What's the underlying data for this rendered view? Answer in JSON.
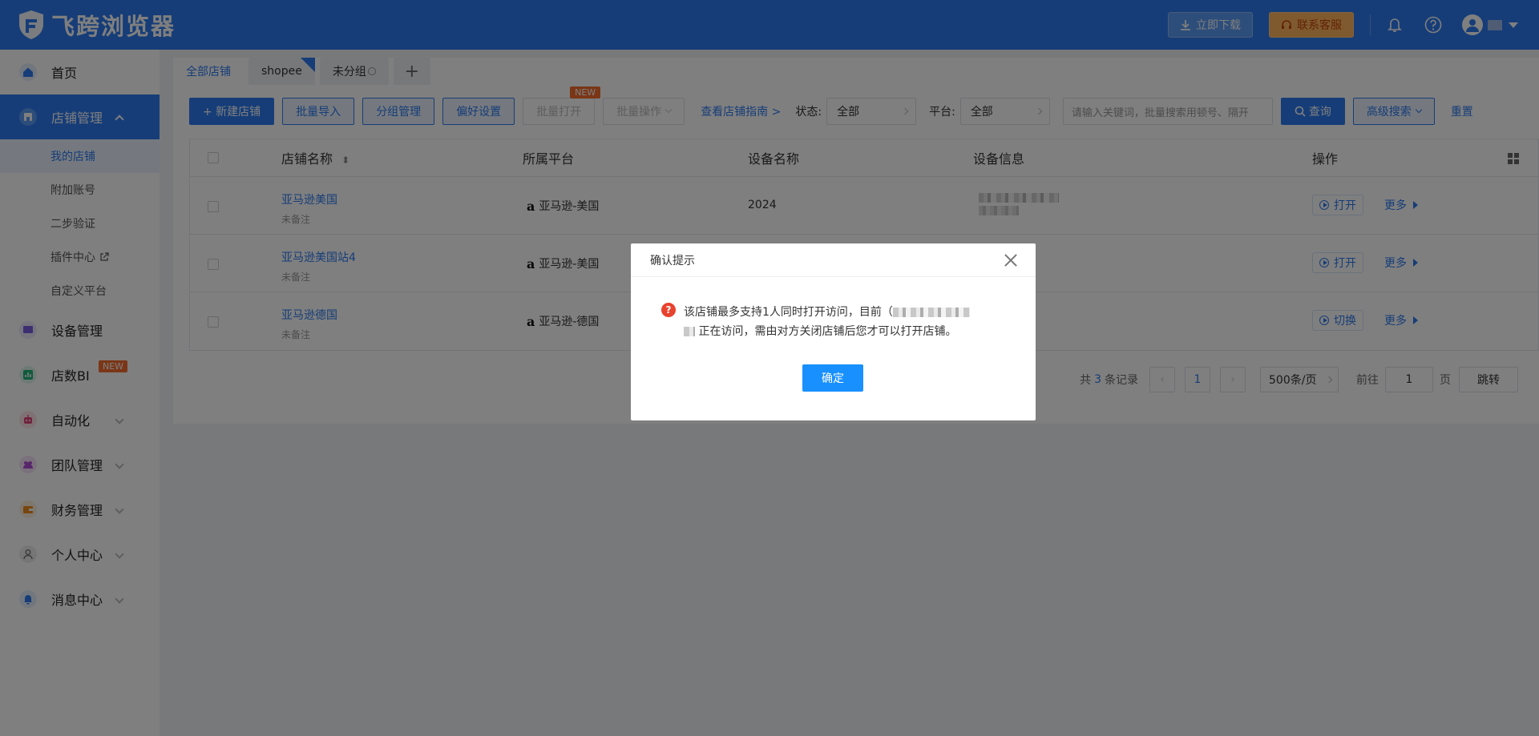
{
  "header": {
    "app_title": "飞跨浏览器",
    "download_label": "立即下载",
    "service_label": "联系客服"
  },
  "sidebar": {
    "items": [
      {
        "label": "首页"
      },
      {
        "label": "店铺管理"
      },
      {
        "label": "设备管理"
      },
      {
        "label": "店数BI",
        "badge": "NEW"
      },
      {
        "label": "自动化"
      },
      {
        "label": "团队管理"
      },
      {
        "label": "财务管理"
      },
      {
        "label": "个人中心"
      },
      {
        "label": "消息中心"
      }
    ],
    "sub_items": [
      {
        "label": "我的店铺"
      },
      {
        "label": "附加账号"
      },
      {
        "label": "二步验证"
      },
      {
        "label": "插件中心"
      },
      {
        "label": "自定义平台"
      }
    ]
  },
  "tabs": [
    {
      "label": "全部店铺"
    },
    {
      "label": "shopee"
    },
    {
      "label": "未分组"
    },
    {
      "label": "+"
    }
  ],
  "toolbar": {
    "new_shop": "+ 新建店铺",
    "batch_import": "批量导入",
    "group_manage": "分组管理",
    "preference": "偏好设置",
    "batch_open": "批量打开",
    "batch_open_badge": "NEW",
    "batch_ops": "批量操作",
    "guide_link": "查看店铺指南 >",
    "status_label": "状态:",
    "status_value": "全部",
    "platform_label": "平台:",
    "platform_value": "全部",
    "search_placeholder": "请输入关键词，批量搜索用顿号、隔开",
    "query": "查询",
    "advanced": "高级搜索",
    "reset": "重置"
  },
  "table": {
    "columns": [
      "店铺名称",
      "所属平台",
      "设备名称",
      "设备信息",
      "操作"
    ],
    "rows": [
      {
        "name": "亚马逊美国",
        "note": "未备注",
        "platform": "亚马逊-美国",
        "device": "2024",
        "action": "打开",
        "more": "更多"
      },
      {
        "name": "亚马逊美国站4",
        "note": "未备注",
        "platform": "亚马逊-美国",
        "device": "",
        "action": "打开",
        "more": "更多"
      },
      {
        "name": "亚马逊德国",
        "note": "未备注",
        "platform": "亚马逊-德国",
        "device": "",
        "action": "切换",
        "more": "更多"
      }
    ]
  },
  "pagination": {
    "total_prefix": "共",
    "total": "3",
    "total_suffix": "条记录",
    "current_page": "1",
    "page_size": "500条/页",
    "goto_label": "前往",
    "goto_value": "1",
    "page_label": "页",
    "jump": "跳转"
  },
  "modal": {
    "title": "确认提示",
    "message_part1": "该店铺最多支持1人同时打开访问，目前（",
    "message_part2": "正在访问，需由对方关闭店铺后您才可以打开店铺。",
    "ok_label": "确定"
  },
  "colors": {
    "primary": "#2d7bf0",
    "danger": "#e8432e",
    "badge": "#f56c2e"
  }
}
